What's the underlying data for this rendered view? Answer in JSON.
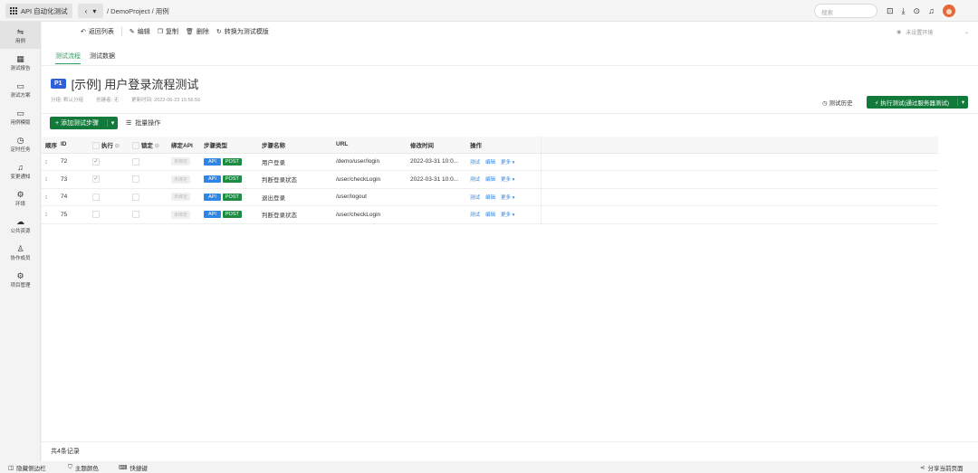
{
  "topbar": {
    "app_name": "API 自动化测试",
    "nav_back": "‹",
    "nav_menu": "▾",
    "breadcrumb": "/ DemoProject / 用例",
    "search_placeholder": "搜索"
  },
  "sidebar": {
    "items": [
      {
        "label": "用例",
        "icon": "⇋"
      },
      {
        "label": "测试报告",
        "icon": "▦"
      },
      {
        "label": "测试方案",
        "icon": "▭"
      },
      {
        "label": "用例模版",
        "icon": "▭"
      },
      {
        "label": "定时任务",
        "icon": "◷"
      },
      {
        "label": "变更通知",
        "icon": "♫"
      },
      {
        "label": "环境",
        "icon": "⚙"
      },
      {
        "label": "公共资源",
        "icon": "☁"
      },
      {
        "label": "协作成员",
        "icon": "♙"
      },
      {
        "label": "项目管理",
        "icon": "⚙"
      }
    ]
  },
  "toolbar": {
    "back": "返回列表",
    "edit": "编辑",
    "copy": "复制",
    "delete": "删除",
    "convert": "转换为测试模版",
    "env_placeholder": "未设置环境"
  },
  "tabs": [
    "测试流程",
    "测试数据"
  ],
  "case": {
    "priority": "P1",
    "title": "[示例] 用户登录流程测试",
    "group": "分组: 默认分组",
    "creator": "创建者: 无",
    "updated": "更新时间: 2022-06-23 15:56:56",
    "history": "测试历史",
    "run_button": "执行测试(通过服务器测试)"
  },
  "actions": {
    "add_step": "添加测试步骤",
    "batch": "批量操作"
  },
  "table": {
    "headers": [
      "顺序",
      "ID",
      "执行",
      "锁定",
      "绑定API",
      "步骤类型",
      "步骤名称",
      "URL",
      "修改时间",
      "操作"
    ],
    "rows": [
      {
        "id": "72",
        "run": true,
        "bind": "未绑定",
        "type": "API",
        "method": "POST",
        "name": "用户登录",
        "url": "/demo/user/login",
        "time": "2022-03-31 10:0..."
      },
      {
        "id": "73",
        "run": true,
        "bind": "未绑定",
        "type": "API",
        "method": "POST",
        "name": "判断登录状态",
        "url": "/user/checkLogin",
        "time": "2022-03-31 10:0..."
      },
      {
        "id": "74",
        "run": false,
        "bind": "未绑定",
        "type": "API",
        "method": "POST",
        "name": "退出登录",
        "url": "/user/logout",
        "time": ""
      },
      {
        "id": "75",
        "run": false,
        "bind": "未绑定",
        "type": "API",
        "method": "POST",
        "name": "判断登录状态",
        "url": "/user/checkLogin",
        "time": ""
      }
    ],
    "op_test": "测试",
    "op_edit": "编辑",
    "op_more": "更多",
    "total": "共4条记录"
  },
  "statusbar": {
    "hide_sidebar": "隐藏侧边栏",
    "theme": "主题颜色",
    "shortcuts": "快捷键",
    "share": "分享当前页面"
  },
  "colors": {
    "primary": "#117a3a",
    "link": "#2f86e6",
    "priority": "#2e5fd9"
  }
}
